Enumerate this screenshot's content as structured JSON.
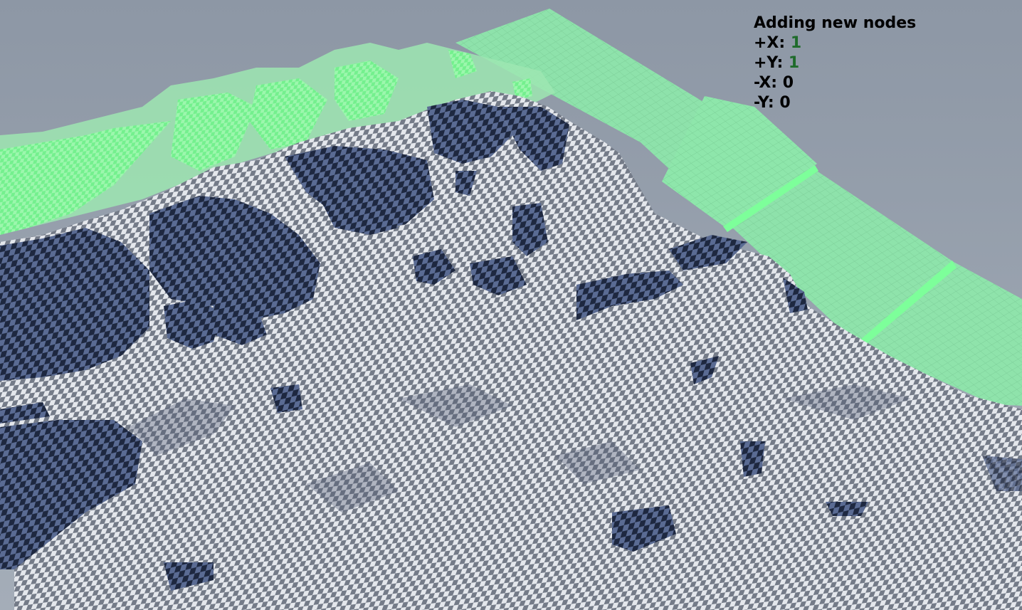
{
  "viewport": {
    "overlay": {
      "title": "Adding new nodes",
      "rows": [
        {
          "label": "+X: ",
          "value": "1",
          "highlight": true
        },
        {
          "label": "+Y: ",
          "value": "1",
          "highlight": true
        },
        {
          "label": "-X: ",
          "value": "0",
          "highlight": false
        },
        {
          "label": "-Y: ",
          "value": "0",
          "highlight": false
        }
      ]
    },
    "colors": {
      "sky": "#8e99a6",
      "new_node_tint": "#8ee8a8",
      "new_node_highlight": "#7dff9a",
      "terrain_light": "#e3e6ec",
      "terrain_dark": "#6f7684",
      "terrain_shadow_light": "#5d6e95",
      "terrain_shadow_dark": "#1f2a42",
      "highlight_value": "#1f6b2b"
    }
  }
}
